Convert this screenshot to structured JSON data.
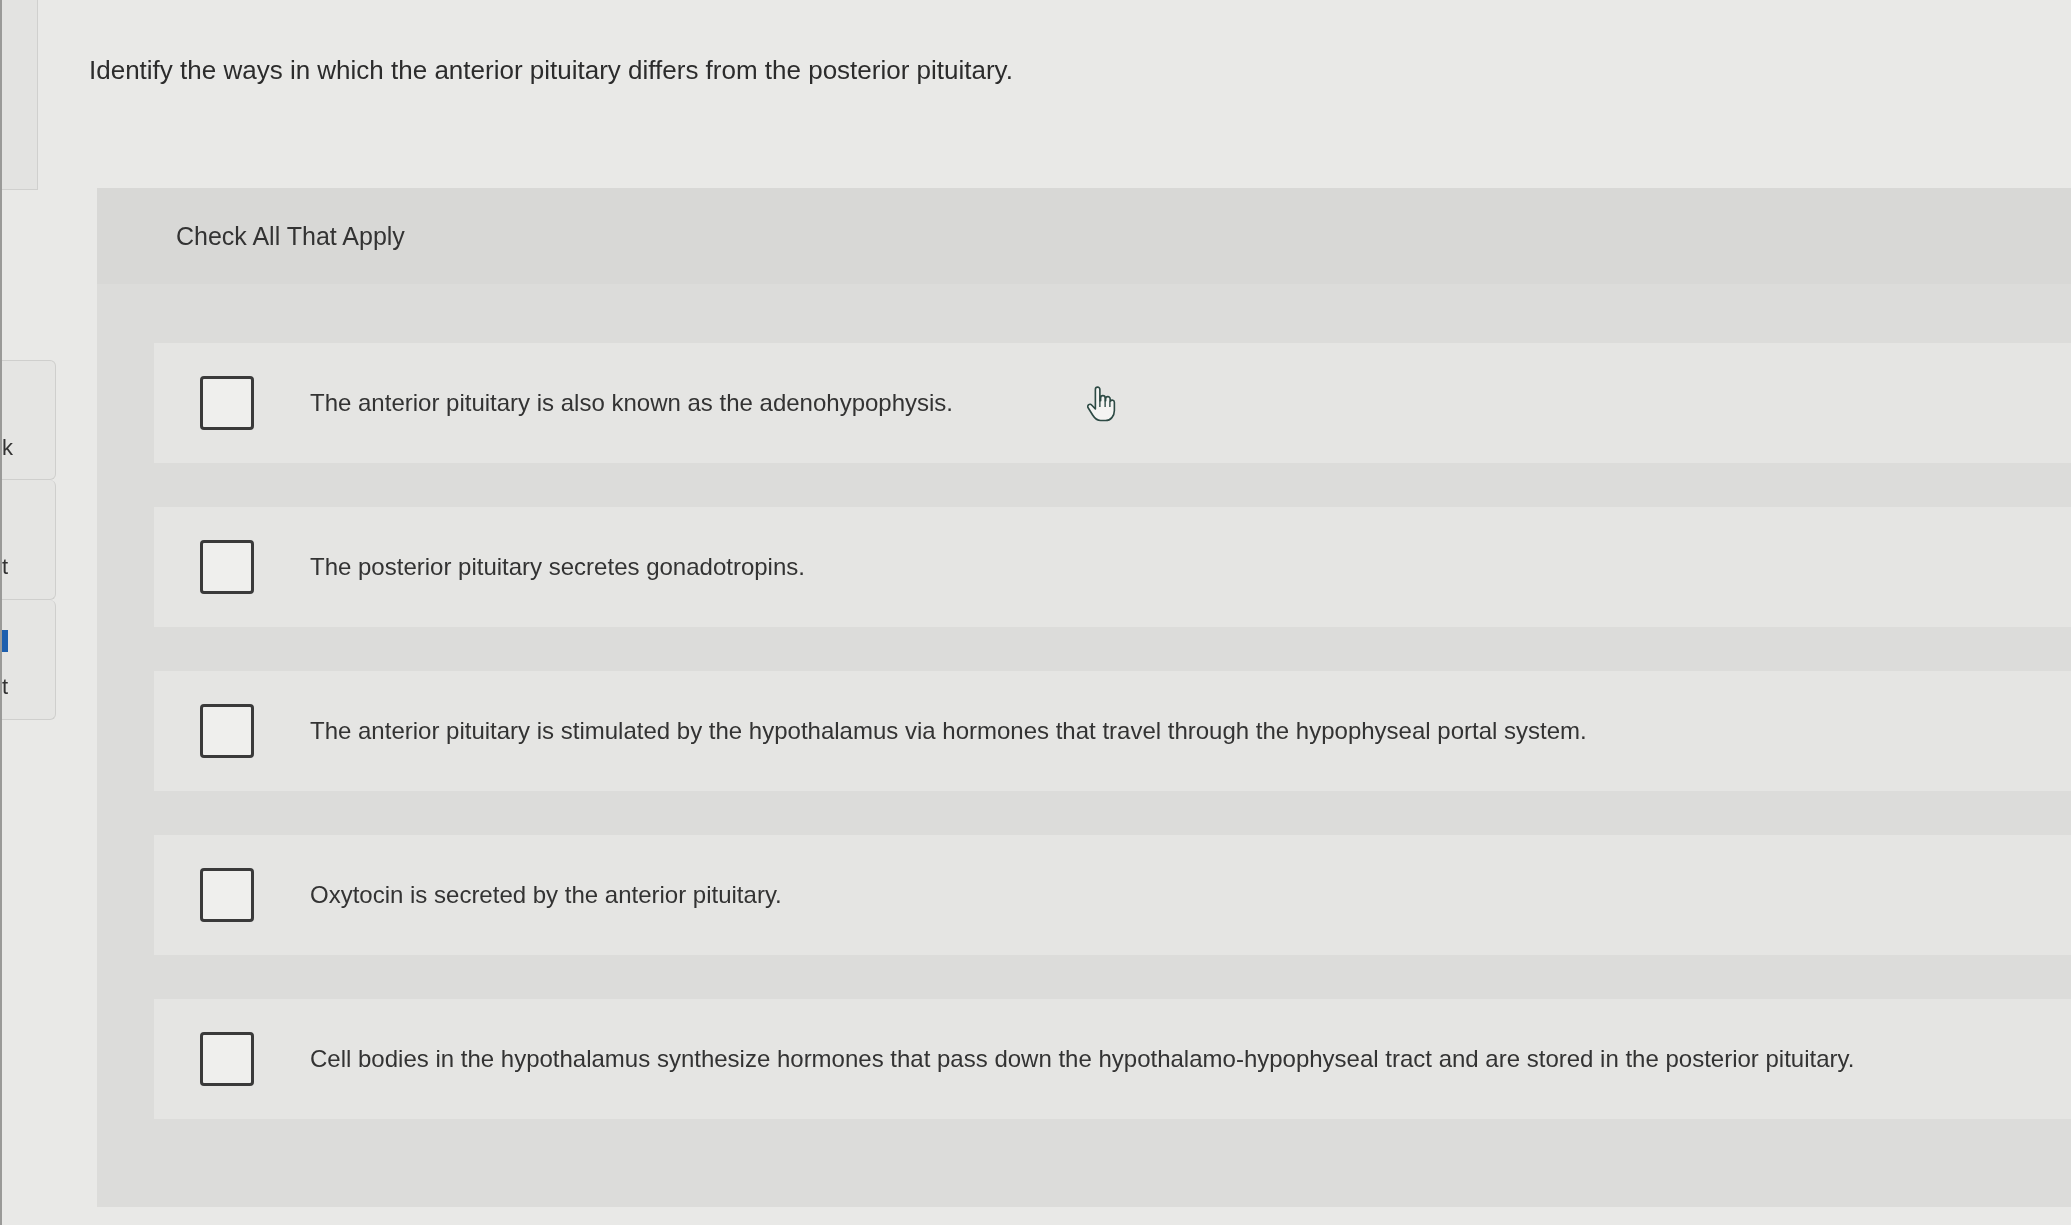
{
  "sidebar": {
    "items": [
      {
        "text": "k",
        "selected": false
      },
      {
        "text": "t",
        "selected": false
      },
      {
        "text": "t",
        "selected": true
      }
    ]
  },
  "question": {
    "prompt": "Identify the ways in which the anterior pituitary differs from the posterior pituitary.",
    "instruction": "Check All That Apply",
    "options": [
      {
        "text": "The anterior pituitary is also known as the adenohypophysis.",
        "checked": false
      },
      {
        "text": "The posterior pituitary secretes gonadotropins.",
        "checked": false
      },
      {
        "text": "The anterior pituitary is stimulated by the hypothalamus via hormones that travel through the hypophyseal portal system.",
        "checked": false
      },
      {
        "text": "Oxytocin is secreted by the anterior pituitary.",
        "checked": false
      },
      {
        "text": "Cell bodies in the hypothalamus synthesize hormones that pass down the hypothalamo-hypophyseal tract and are stored in the posterior pituitary.",
        "checked": false
      }
    ]
  }
}
